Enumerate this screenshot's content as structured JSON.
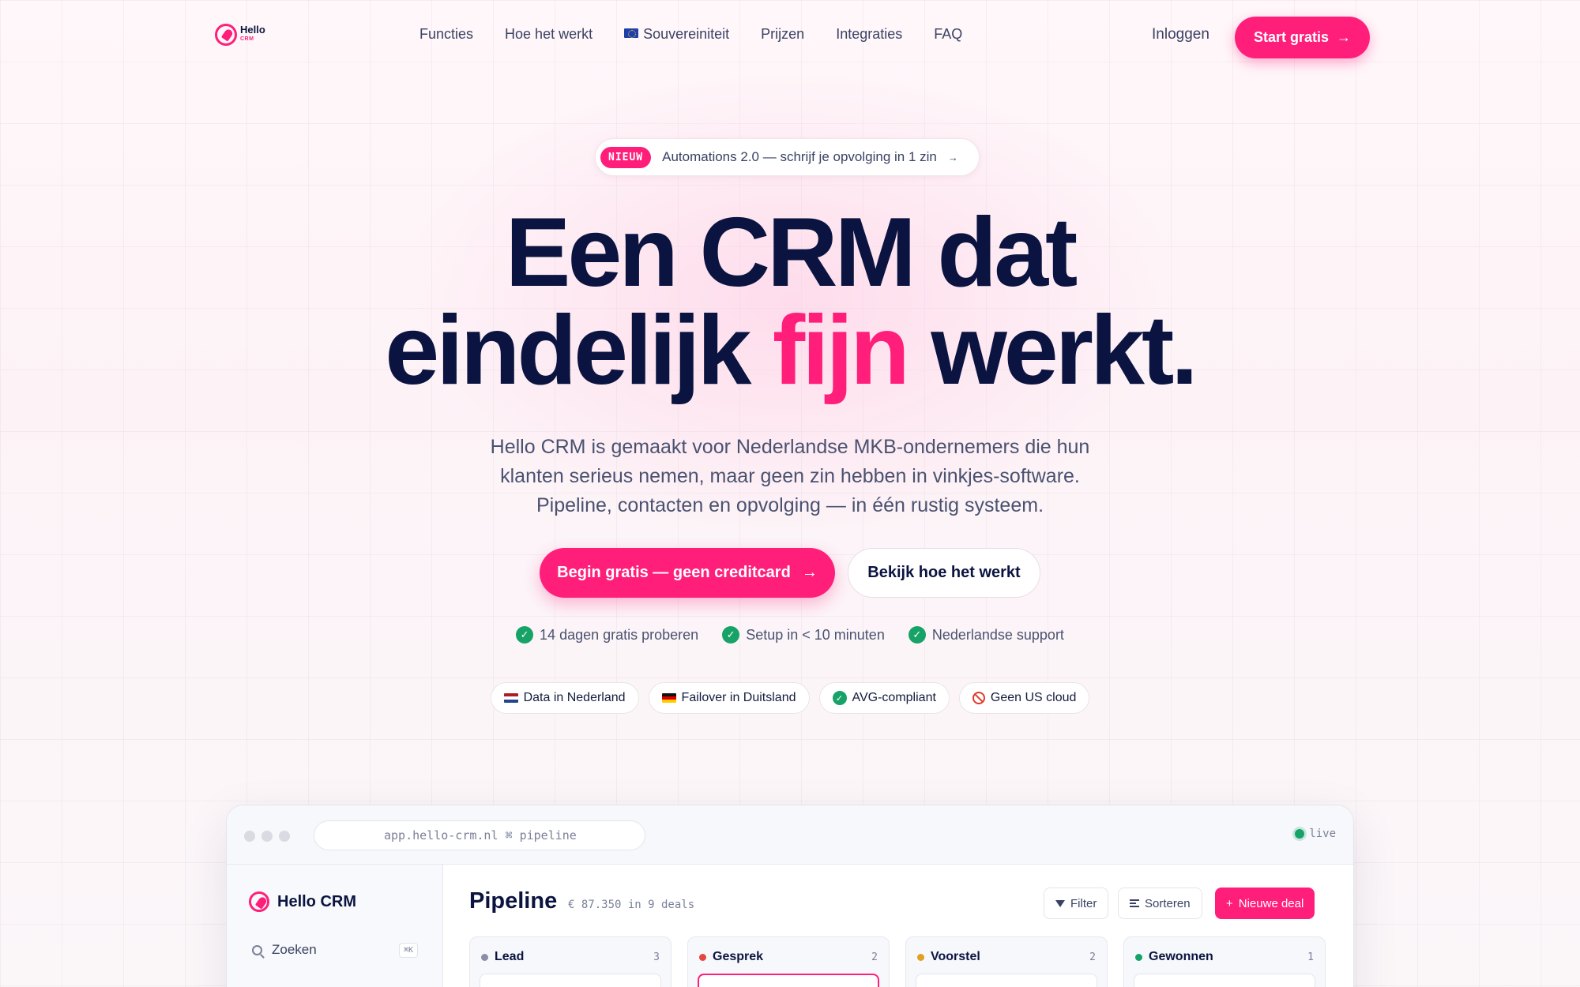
{
  "brand": {
    "name": "Hello",
    "sub": "CRM"
  },
  "nav": {
    "items": [
      "Functies",
      "Hoe het werkt",
      "Souvereiniteit",
      "Prijzen",
      "Integraties",
      "FAQ"
    ],
    "login": "Inloggen",
    "start": "Start gratis"
  },
  "announcement": {
    "badge": "NIEUW",
    "text": "Automations 2.0 — schrijf je opvolging in 1 zin"
  },
  "hero": {
    "line1": "Een CRM dat",
    "line2_pre": "eindelijk ",
    "line2_accent": "fijn",
    "line2_post": " werkt.",
    "sub1": "Hello CRM is gemaakt voor Nederlandse MKB-ondernemers die hun",
    "sub2": "klanten serieus nemen, maar geen zin hebben in vinkjes-software.",
    "sub3": "Pipeline, contacten en opvolging — in één rustig systeem."
  },
  "cta": {
    "primary": "Begin gratis — geen creditcard",
    "secondary": "Bekijk hoe het werkt"
  },
  "checks": [
    "14 dagen gratis proberen",
    "Setup in < 10 minuten",
    "Nederlandse support"
  ],
  "badges": [
    "Data in Nederland",
    "Failover in Duitsland",
    "AVG-compliant",
    "Geen US cloud"
  ],
  "app": {
    "url": "app.hello-crm.nl ⌘ pipeline",
    "live": "live",
    "brand": "Hello CRM",
    "search": "Zoeken",
    "shortcut": "⌘K",
    "title": "Pipeline",
    "meta": "€ 87.350 in 9 deals",
    "filter": "Filter",
    "sort": "Sorteren",
    "new_deal": "Nieuwe deal",
    "columns": [
      {
        "name": "Lead",
        "count": "3",
        "color": "#8a8fa3"
      },
      {
        "name": "Gesprek",
        "count": "2",
        "color": "#e5483b"
      },
      {
        "name": "Voorstel",
        "count": "2",
        "color": "#e0a020"
      },
      {
        "name": "Gewonnen",
        "count": "1",
        "color": "#17a268"
      }
    ]
  },
  "colors": {
    "accent": "#ff1f7a",
    "ink": "#0b1440",
    "success": "#17a268"
  }
}
